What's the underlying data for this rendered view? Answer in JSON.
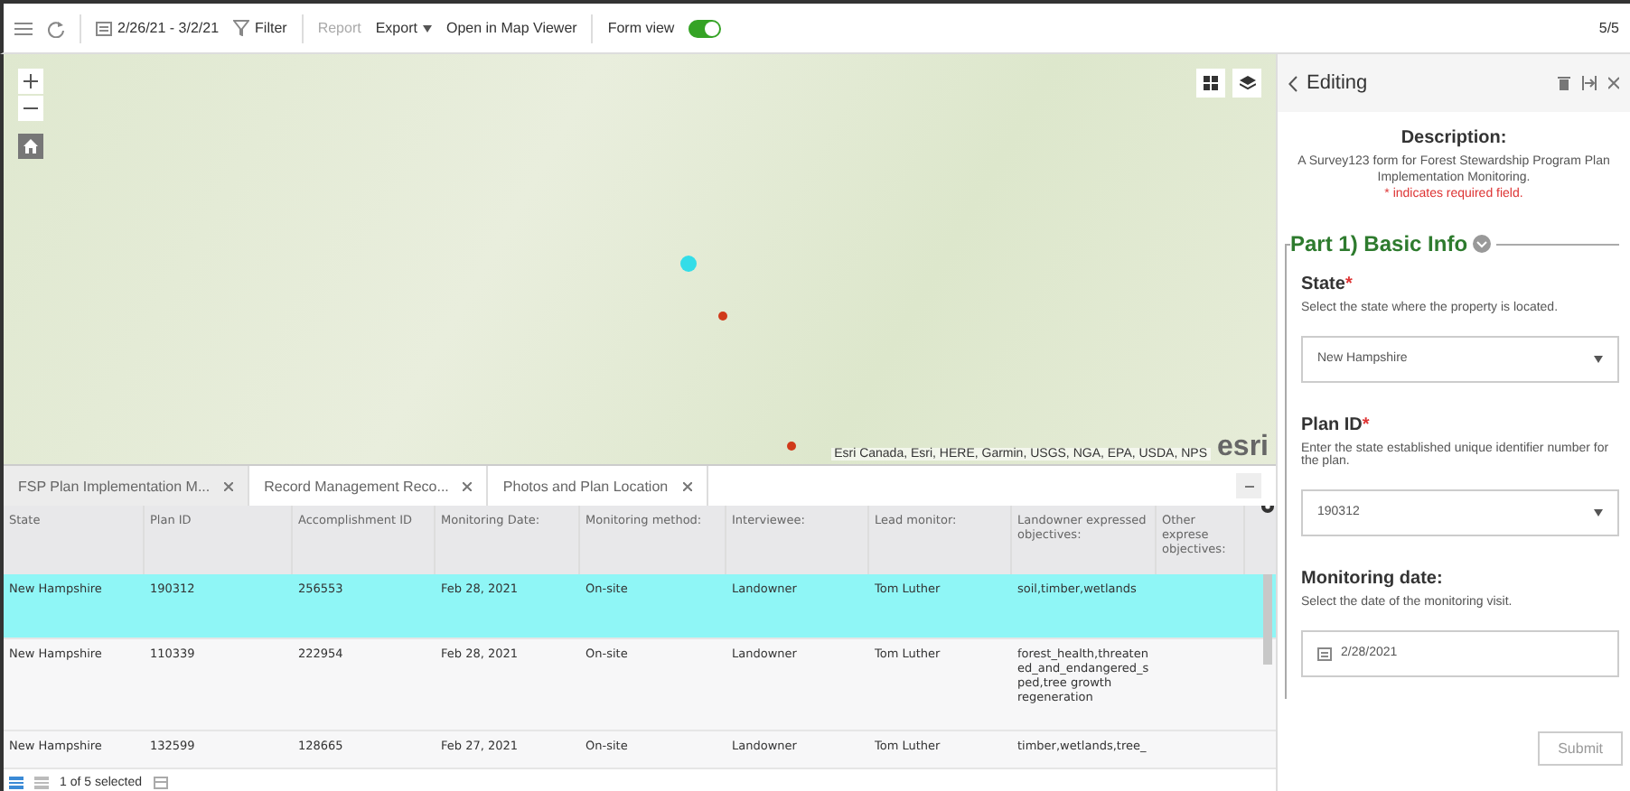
{
  "toolbar": {
    "date_range": "2/26/21 - 3/2/21",
    "filter": "Filter",
    "actions": [
      {
        "label": "Report",
        "disabled": true
      },
      {
        "label": "Export",
        "disabled": false,
        "dropdown": true
      },
      {
        "label": "Open in Map Viewer",
        "disabled": false,
        "dropdown": false
      }
    ],
    "form_view": {
      "label": "Form view",
      "on": true
    },
    "count": "5/5"
  },
  "map": {
    "attribution": "Esri Canada, Esri, HERE, Garmin, USGS, NGA, EPA, USDA, NPS",
    "logo": "esri",
    "markers": [
      {
        "color": "#33dde8",
        "selected": true
      },
      {
        "color": "#d03a1a",
        "selected": false
      },
      {
        "color": "#d03a1a",
        "selected": false
      }
    ]
  },
  "table": {
    "tabs": [
      {
        "label": "FSP Plan Implementation M...",
        "selected": true
      },
      {
        "label": "Record Management Reco...",
        "selected": false
      },
      {
        "label": "Photos and Plan Location",
        "selected": false
      }
    ],
    "columns": [
      "State",
      "Plan ID",
      "Accomplishment ID",
      "Monitoring Date:",
      "Monitoring method:",
      "Interviewee:",
      "Lead monitor:",
      "Landowner expressed objectives:",
      "Other exprese objectives:"
    ],
    "rows": [
      {
        "selected": true,
        "cells": [
          "New Hampshire",
          "190312",
          "256553",
          "Feb 28, 2021",
          "On-site",
          "Landowner",
          "Tom Luther",
          "soil,timber,wetlands",
          ""
        ]
      },
      {
        "selected": false,
        "cells": [
          "New Hampshire",
          "110339",
          "222954",
          "Feb 28, 2021",
          "On-site",
          "Landowner",
          "Tom Luther",
          "forest_health,threatened_and_endangered_sped,tree growth regeneration",
          ""
        ]
      },
      {
        "selected": false,
        "cells": [
          "New Hampshire",
          "132599",
          "128665",
          "Feb 27, 2021",
          "On-site",
          "Landowner",
          "Tom Luther",
          "timber,wetlands,tree_",
          ""
        ]
      }
    ],
    "status": "1 of 5 selected"
  },
  "panel": {
    "title": "Editing",
    "description_title": "Description:",
    "description": "A Survey123 form for Forest Stewardship Program Plan Implementation Monitoring.",
    "required_note": "* indicates required field.",
    "group": "Part 1) Basic Info",
    "fields": [
      {
        "kind": "dropdown",
        "label": "State",
        "required_mark": "*",
        "hint": "Select the state where the property is located.",
        "value": "New Hampshire"
      },
      {
        "kind": "dropdown",
        "label": "Plan ID",
        "required_mark": "*",
        "hint": "Enter the state established unique identifier number for the plan.",
        "value": "190312"
      },
      {
        "kind": "date",
        "label": "Monitoring date:",
        "hint": "Select the date of the monitoring visit.",
        "value": "2/28/2021"
      }
    ],
    "submit": {
      "label": "Submit",
      "disabled": true
    }
  }
}
